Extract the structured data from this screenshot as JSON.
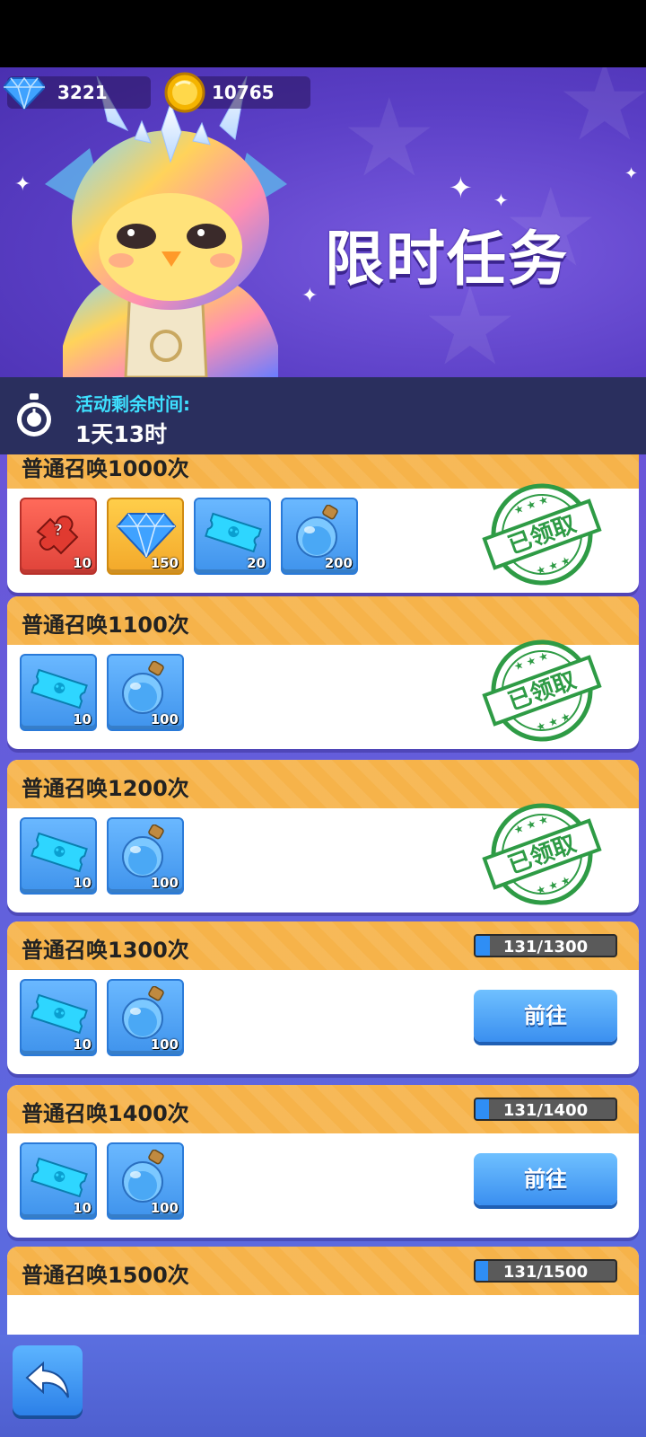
{
  "currency": {
    "gems": "3221",
    "coins": "10765"
  },
  "banner": {
    "title": "限时任务"
  },
  "timer": {
    "label": "活动剩余时间:",
    "value": "1天13时"
  },
  "tasks": [
    {
      "title": "普通召唤1000次",
      "status": "claimed",
      "stamp": "已领取",
      "rewards": [
        {
          "icon": "mystery-puzzle-icon",
          "qty": "10",
          "style": "red"
        },
        {
          "icon": "diamond-icon",
          "qty": "150",
          "style": "gold"
        },
        {
          "icon": "summon-ticket-icon",
          "qty": "20",
          "style": "blue"
        },
        {
          "icon": "potion-bottle-icon",
          "qty": "200",
          "style": "blue"
        }
      ]
    },
    {
      "title": "普通召唤1100次",
      "status": "claimed",
      "stamp": "已领取",
      "rewards": [
        {
          "icon": "summon-ticket-icon",
          "qty": "10",
          "style": "blue"
        },
        {
          "icon": "potion-bottle-icon",
          "qty": "100",
          "style": "blue"
        }
      ]
    },
    {
      "title": "普通召唤1200次",
      "status": "claimed",
      "stamp": "已领取",
      "rewards": [
        {
          "icon": "summon-ticket-icon",
          "qty": "10",
          "style": "blue"
        },
        {
          "icon": "potion-bottle-icon",
          "qty": "100",
          "style": "blue"
        }
      ]
    },
    {
      "title": "普通召唤1300次",
      "status": "in-progress",
      "progress": "131/1300",
      "progress_fraction": 0.1008,
      "button": "前往",
      "rewards": [
        {
          "icon": "summon-ticket-icon",
          "qty": "10",
          "style": "blue"
        },
        {
          "icon": "potion-bottle-icon",
          "qty": "100",
          "style": "blue"
        }
      ]
    },
    {
      "title": "普通召唤1400次",
      "status": "in-progress",
      "progress": "131/1400",
      "progress_fraction": 0.0936,
      "button": "前往",
      "rewards": [
        {
          "icon": "summon-ticket-icon",
          "qty": "10",
          "style": "blue"
        },
        {
          "icon": "potion-bottle-icon",
          "qty": "100",
          "style": "blue"
        }
      ]
    },
    {
      "title": "普通召唤1500次",
      "status": "in-progress",
      "progress": "131/1500",
      "progress_fraction": 0.0873,
      "rewards": []
    }
  ],
  "colors": {
    "header": "#f6b34a",
    "accent": "#3a8ff0",
    "stamp": "#2e9b45",
    "banner": "#5b3fc6"
  }
}
